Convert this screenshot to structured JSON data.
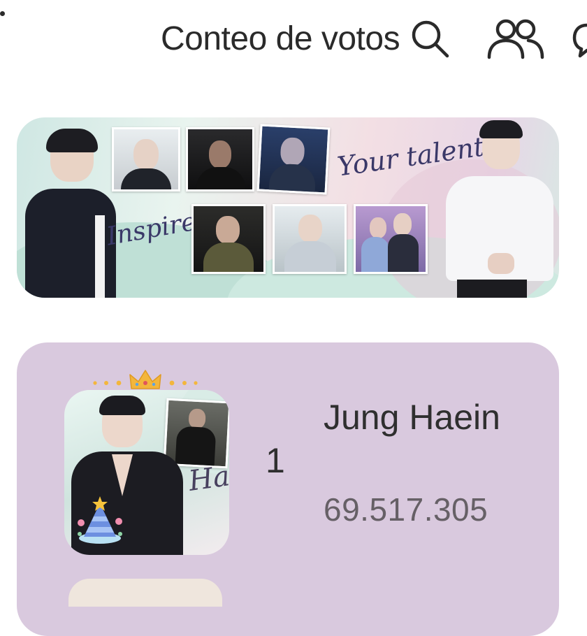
{
  "header": {
    "title": "Conteo de votos",
    "icons": [
      "search-icon",
      "people-icon",
      "chat-icon"
    ]
  },
  "banner": {
    "script_top": "Your talent",
    "script_left": "Inspires"
  },
  "ranking": [
    {
      "rank": "1",
      "name": "Jung Haein",
      "votes": "69.517.305",
      "thumb_script": "Ha"
    }
  ],
  "colors": {
    "card_bg": "#d9c9de",
    "text": "#2f2f2f",
    "votes": "#666066",
    "crown": "#f3b63c"
  }
}
